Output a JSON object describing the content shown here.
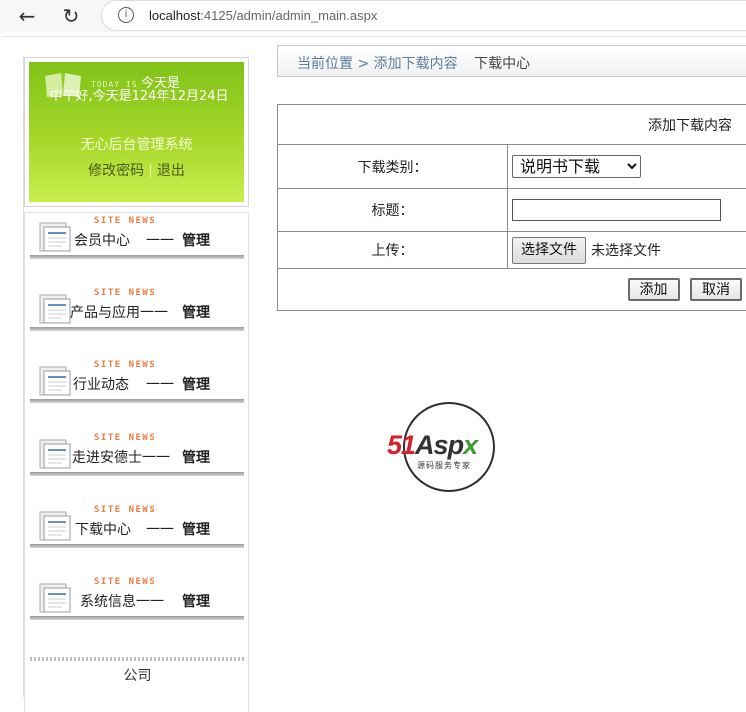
{
  "browser": {
    "url_host": "localhost",
    "url_path": ":4125/admin/admin_main.aspx"
  },
  "welcome": {
    "today_label": "TODAY IS",
    "greeting_user": "今天是",
    "greeting_line": "中午好,今天是124年12月24日",
    "system_name": "无心后台管理系统",
    "change_password": "修改密码",
    "separator": "|",
    "logout": "退出"
  },
  "menu": {
    "badge": "SITE NEWS",
    "dash": "一一",
    "manage": "管理",
    "items": [
      {
        "title": "会员中心"
      },
      {
        "title": "产品与应用一一"
      },
      {
        "title": "行业动态"
      },
      {
        "title": "走进安德士一一"
      },
      {
        "title": "下载中心"
      },
      {
        "title": "系统信息一一"
      }
    ],
    "company": "公司"
  },
  "breadcrumb": {
    "prefix": "当前位置",
    "arrow": ">",
    "page": "添加下载内容",
    "section": "下载中心"
  },
  "form": {
    "title": "添加下载内容",
    "category_label": "下载类别：",
    "category_value": "说明书下载",
    "title_label": "标题：",
    "title_value": "",
    "upload_label": "上传：",
    "file_button": "选择文件",
    "file_status": "未选择文件",
    "add_button": "添加",
    "cancel_button": "取消"
  },
  "logo": {
    "brand_51": "51",
    "brand_a": "A",
    "brand_sp": "sp",
    "brand_x": "x",
    "tagline": "源码服务专家"
  },
  "colors": {
    "welcome_green": "#8cc81e",
    "site_news_orange": "#f07b3c",
    "breadcrumb_link": "#5b7d9f",
    "logo_red": "#d6202a",
    "logo_green": "#3e9b2e"
  }
}
